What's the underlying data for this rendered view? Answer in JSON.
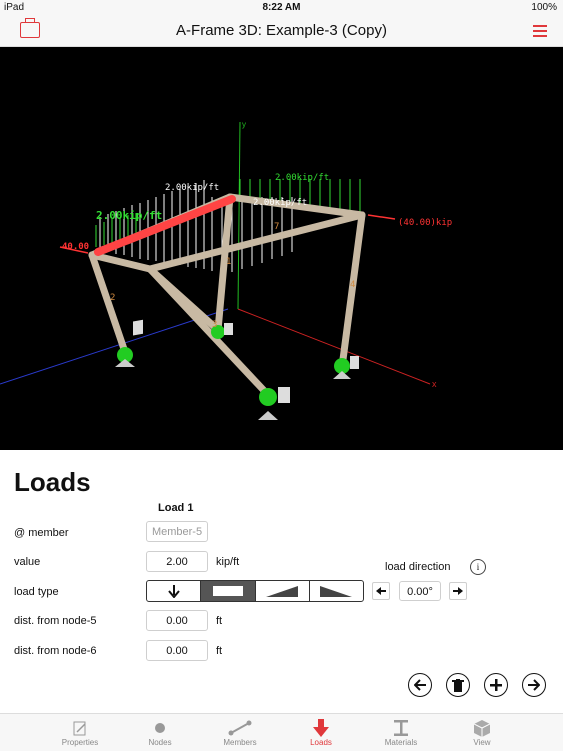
{
  "status_bar": {
    "device": "iPad",
    "time": "8:22 AM",
    "battery": "100%"
  },
  "nav": {
    "title": "A-Frame 3D: Example-3 (Copy)"
  },
  "viewport": {
    "labels": {
      "load_green_top": "2.00kip/ft",
      "load_green_left": "2.00kip/ft",
      "load_white_left": "2.00kip/ft",
      "load_white_mid": "2.00kip/ft",
      "point_load_right": "(40.00)kip",
      "point_load_left": "40.00",
      "axis_x": "x",
      "axis_y": "y",
      "member_1": "1",
      "member_2": "2",
      "member_3": "3",
      "member_4": "4",
      "member_7": "7"
    }
  },
  "loads": {
    "title": "Loads",
    "column_header": "Load 1",
    "member_label": "@ member",
    "member_placeholder": "Member-5",
    "value_label": "value",
    "value": "2.00",
    "value_unit": "kip/ft",
    "load_type_label": "load type",
    "load_direction_label": "load direction",
    "load_direction_value": "0.00°",
    "info": "i",
    "dist1_label": "dist. from node-5",
    "dist1_value": "0.00",
    "dist1_unit": "ft",
    "dist2_label": "dist. from node-6",
    "dist2_value": "0.00",
    "dist2_unit": "ft"
  },
  "tabs": [
    {
      "label": "Properties",
      "icon": "edit-icon"
    },
    {
      "label": "Nodes",
      "icon": "node-icon"
    },
    {
      "label": "Members",
      "icon": "member-icon"
    },
    {
      "label": "Loads",
      "icon": "load-arrow-icon"
    },
    {
      "label": "Materials",
      "icon": "i-beam-icon"
    },
    {
      "label": "View",
      "icon": "cube-icon"
    }
  ],
  "colors": {
    "accent": "#e0383b",
    "viewport_bg": "#000000",
    "member": "#c8b9a3",
    "support": "#22cc22"
  }
}
